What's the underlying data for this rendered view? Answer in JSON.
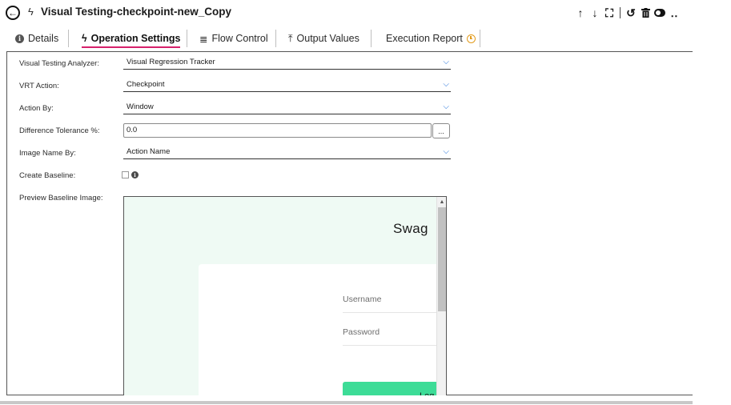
{
  "header": {
    "back_icon": "arrow-left-circle-icon",
    "title_icon": "bolt-icon",
    "title": "Visual Testing-checkpoint-new_Copy",
    "toolbar_icons": [
      "arrow-up-icon",
      "arrow-down-icon",
      "expand-icon",
      "undo-icon",
      "trash-icon",
      "toggle-icon",
      "more-icon"
    ]
  },
  "tabs": [
    {
      "label": "Details",
      "icon": "info-icon",
      "active": false
    },
    {
      "label": "Operation Settings",
      "icon": "bolt-icon",
      "active": true
    },
    {
      "label": "Flow Control",
      "icon": "flow-icon",
      "active": false
    },
    {
      "label": "Output Values",
      "icon": "upload-icon",
      "active": false
    },
    {
      "label": "Execution Report",
      "icon": "clock-icon",
      "active": false
    }
  ],
  "form": {
    "analyzer": {
      "label": "Visual Testing Analyzer:",
      "value": "Visual Regression Tracker"
    },
    "vrt_action": {
      "label": "VRT Action:",
      "value": "Checkpoint"
    },
    "action_by": {
      "label": "Action By:",
      "value": "Window"
    },
    "tolerance": {
      "label": "Difference Tolerance %:",
      "value": "0.0",
      "button": "..."
    },
    "image_name_by": {
      "label": "Image Name By:",
      "value": "Action Name"
    },
    "create_baseline": {
      "label": "Create Baseline:",
      "checked": false
    },
    "preview": {
      "label": "Preview Baseline Image:"
    }
  },
  "preview_image": {
    "title": "Swag",
    "username_placeholder": "Username",
    "password_placeholder": "Password",
    "login_button": "Log"
  },
  "colors": {
    "active_tab_underline": "#d6216b",
    "chevron": "#1e6fd9",
    "clock": "#e29b1c",
    "preview_bg": "#effaf4",
    "login_button": "#3ddc97"
  }
}
